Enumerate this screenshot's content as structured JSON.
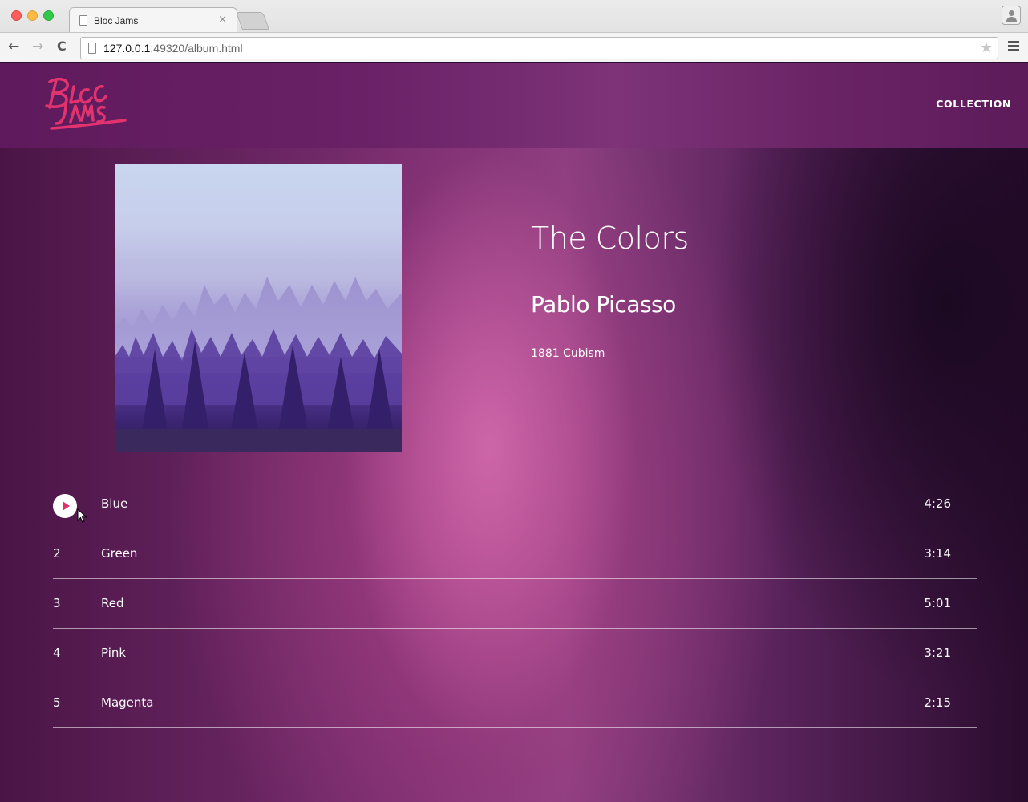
{
  "browser": {
    "tab_title": "Bloc Jams",
    "tab_close": "×",
    "url_host": "127.0.0.1",
    "url_rest": ":49320/album.html"
  },
  "navbar": {
    "logo_text": "Bloc Jams",
    "collection_link": "COLLECTION"
  },
  "album": {
    "title": "The Colors",
    "artist": "Pablo Picasso",
    "release_info": "1881 Cubism"
  },
  "songs": [
    {
      "number": "1",
      "title": "Blue",
      "duration": "4:26",
      "state": "hover-play"
    },
    {
      "number": "2",
      "title": "Green",
      "duration": "3:14"
    },
    {
      "number": "3",
      "title": "Red",
      "duration": "5:01"
    },
    {
      "number": "4",
      "title": "Pink",
      "duration": "3:21"
    },
    {
      "number": "5",
      "title": "Magenta",
      "duration": "2:15"
    }
  ],
  "colors": {
    "accent": "#e3336f",
    "navbar": "#6a2166",
    "text": "#ffffff"
  }
}
